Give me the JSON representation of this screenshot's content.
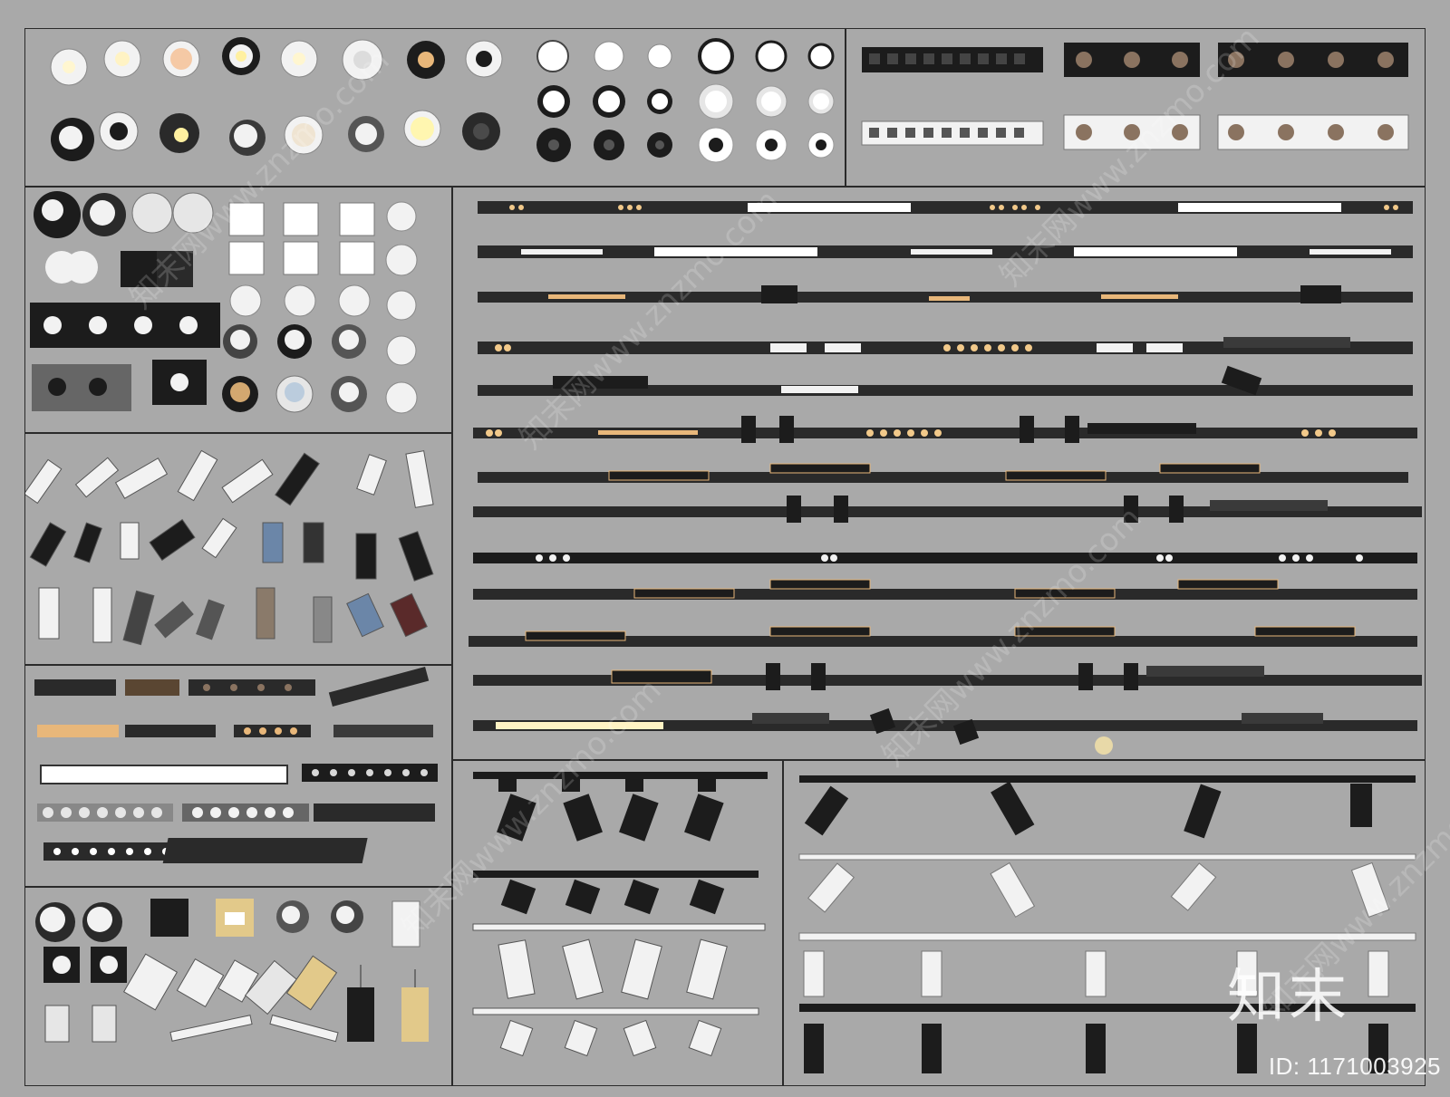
{
  "watermark": {
    "brand_mark": "知末",
    "image_id": "ID: 1171003925",
    "tiles": [
      "知末网www.znzmo.com",
      "知末网www.znzmo.com",
      "知末网www.znzmo.com",
      "知末网www.znzmo.com",
      "知末网www.znzmo.com",
      "知末网www.znzmo.com"
    ]
  },
  "colors": {
    "background": "#a9a9a9",
    "fixture_black": "#1c1c1c",
    "fixture_dark": "#3a3a3a",
    "fixture_white": "#f2f2f2",
    "led_warm": "#e8b77a",
    "led_glow": "#fff3c4"
  },
  "panels": [
    {
      "name": "panel-round-downlights",
      "content": "round recessed downlights"
    },
    {
      "name": "panel-linear-grille-lights",
      "content": "linear grille spotlights"
    },
    {
      "name": "panel-surface-cylinder-lights",
      "content": "surface-mounted cylinder lights"
    },
    {
      "name": "panel-magnetic-track-system",
      "content": "magnetic track rails with modules"
    },
    {
      "name": "panel-track-spotlights",
      "content": "track spotlights"
    },
    {
      "name": "panel-linear-modules",
      "content": "linear light modules"
    },
    {
      "name": "panel-misc-fixtures",
      "content": "misc fixtures and pendants"
    },
    {
      "name": "panel-black-track-rails",
      "content": "black track rails with spotlights"
    },
    {
      "name": "panel-large-track-rails",
      "content": "large track rails with spotlights"
    }
  ]
}
